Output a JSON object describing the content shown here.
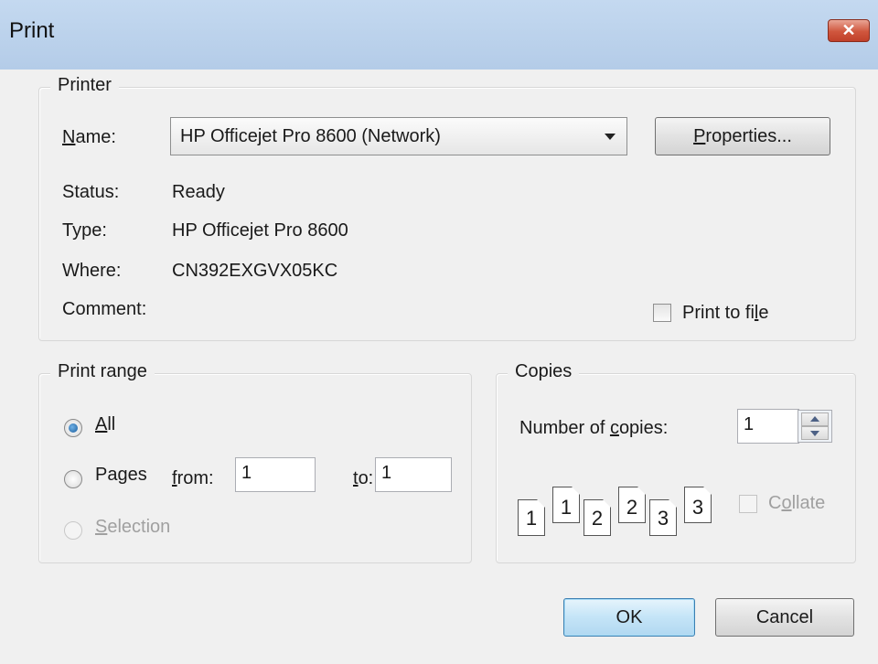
{
  "window": {
    "title": "Print",
    "close_label": "✕"
  },
  "printer": {
    "group_label": "Printer",
    "name_label": "Name:",
    "name_value": "HP Officejet Pro 8600 (Network)",
    "properties_label": "Properties...",
    "status_label": "Status:",
    "status_value": "Ready",
    "type_label": "Type:",
    "type_value": "HP Officejet Pro 8600",
    "where_label": "Where:",
    "where_value": "CN392EXGVX05KC",
    "comment_label": "Comment:",
    "comment_value": "",
    "print_to_file_label": "Print to file",
    "print_to_file_checked": false
  },
  "range": {
    "group_label": "Print range",
    "all_label": "All",
    "all_selected": true,
    "pages_label": "Pages",
    "from_label": "from:",
    "from_value": "1",
    "to_label": "to:",
    "to_value": "1",
    "selection_label": "Selection",
    "selection_enabled": false
  },
  "copies": {
    "group_label": "Copies",
    "number_label": "Number of copies:",
    "number_value": "1",
    "collate_label": "Collate",
    "collate_enabled": false,
    "pages": [
      {
        "back": "1",
        "front": "1"
      },
      {
        "back": "2",
        "front": "2"
      },
      {
        "back": "3",
        "front": "3"
      }
    ]
  },
  "buttons": {
    "ok": "OK",
    "cancel": "Cancel"
  },
  "colors": {
    "titlebar": "#c4d9f0",
    "close_button": "#d0563d",
    "default_button": "#c4e4f7"
  }
}
